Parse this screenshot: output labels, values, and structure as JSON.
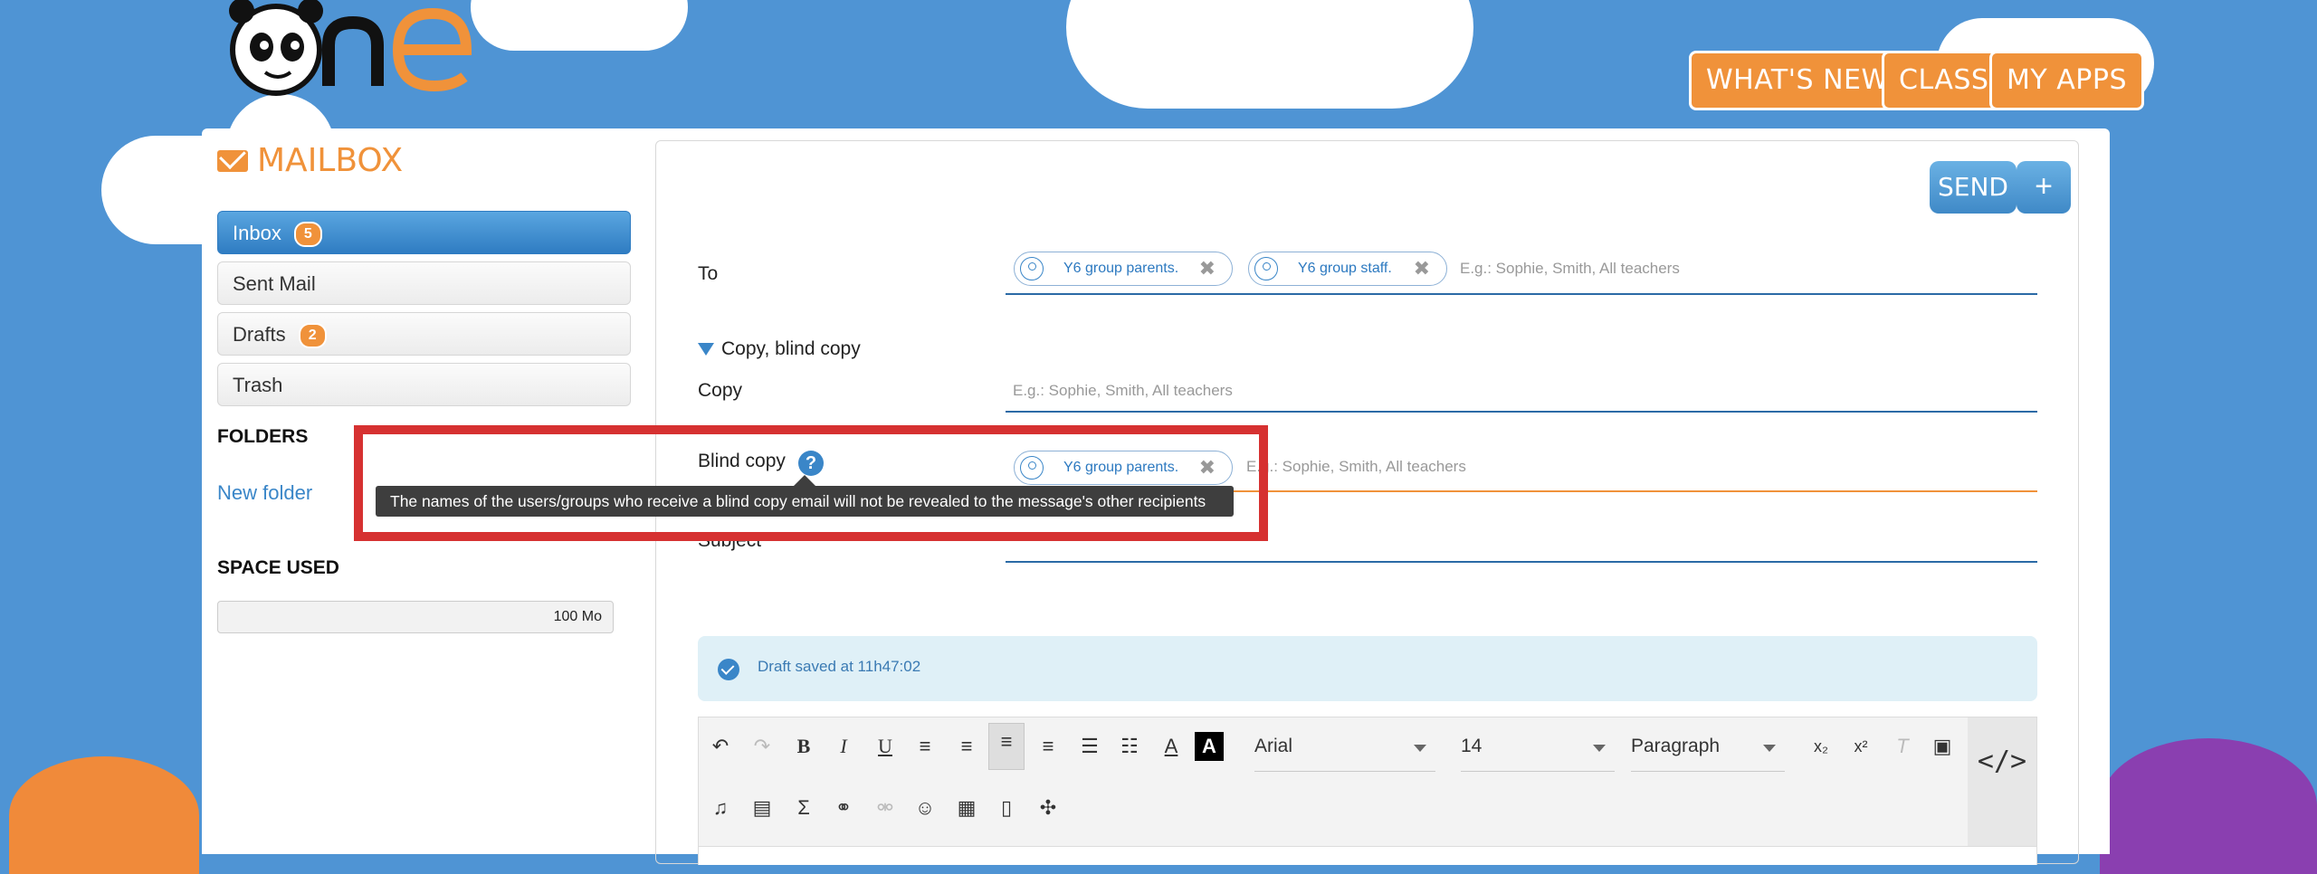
{
  "header": {
    "logo_text": "One",
    "buttons": [
      {
        "label": "WHAT'S NEW?"
      },
      {
        "label": "CLASS"
      },
      {
        "label": "MY APPS"
      }
    ]
  },
  "sidebar": {
    "title": "MAILBOX",
    "items": [
      {
        "label": "Inbox",
        "badge": "5"
      },
      {
        "label": "Sent Mail"
      },
      {
        "label": "Drafts",
        "badge": "2"
      },
      {
        "label": "Trash"
      }
    ],
    "folders_title": "FOLDERS",
    "new_folder": "New folder",
    "space_title": "SPACE USED",
    "space_value": "100 Mo"
  },
  "compose": {
    "send_label": "SEND",
    "plus_label": "+",
    "to_label": "To",
    "to_chips": [
      "Y6 group parents.",
      "Y6 group staff."
    ],
    "placeholder": "E.g.: Sophie, Smith, All teachers",
    "cc_toggle": "Copy, blind copy",
    "copy_label": "Copy",
    "bcc_label": "Blind copy",
    "bcc_chips": [
      "Y6 group parents."
    ],
    "help_glyph": "?",
    "tooltip": "The names of the users/groups who receive a blind copy email will not be revealed to the message's other recipients",
    "subject_label": "Subject",
    "draft_notice": "Draft saved at 11h47:02"
  },
  "editor": {
    "font_family": "Arial",
    "font_size": "14",
    "block_format": "Paragraph",
    "source_label": "</>"
  },
  "colors": {
    "background": "#4f94d4",
    "accent": "#f0923a",
    "link": "#3a86c8",
    "highlight_box": "#d63131"
  }
}
